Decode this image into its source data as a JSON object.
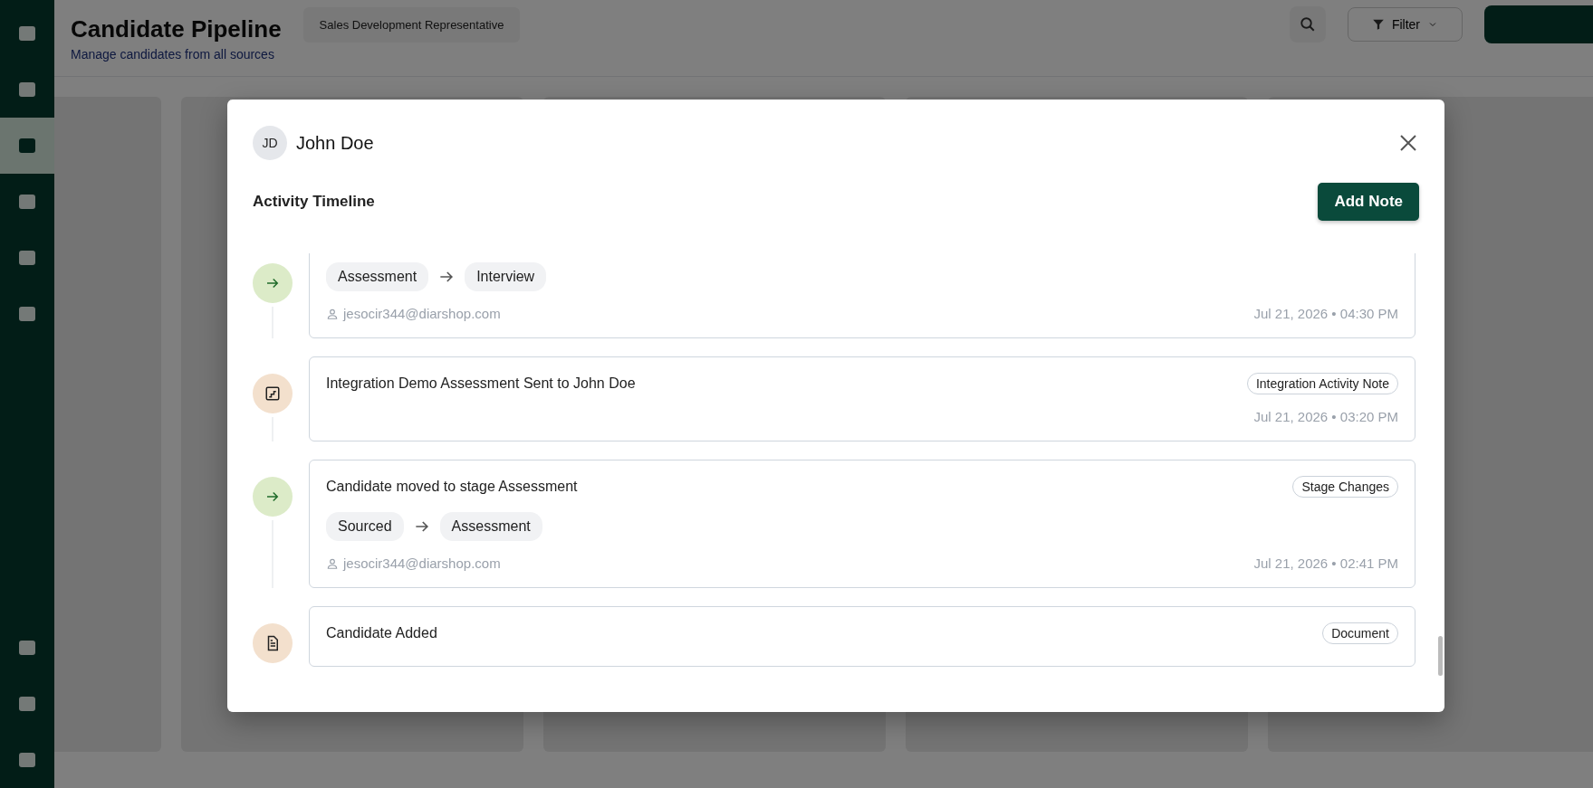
{
  "page": {
    "title": "Candidate Pipeline",
    "subtitle": "Manage candidates from all sources",
    "job_select": "Sales Development Representative",
    "filter_button": "Filter"
  },
  "sidebar": {
    "items": [
      {
        "selected": false
      },
      {
        "selected": false
      },
      {
        "selected": true
      },
      {
        "selected": false
      },
      {
        "selected": false
      },
      {
        "selected": false
      }
    ],
    "bottom_items": [
      {
        "selected": false
      },
      {
        "selected": false
      },
      {
        "selected": false
      }
    ]
  },
  "modal": {
    "avatar_initials": "JD",
    "name": "John Doe",
    "section_title": "Activity Timeline",
    "add_button": "Add Note",
    "activities": [
      {
        "kind": "stage_change",
        "from": "Assessment",
        "to": "Interview",
        "user": "jesocir344@diarshop.com",
        "time": "Jul 21, 2026 • 04:30 PM"
      },
      {
        "kind": "integration",
        "title": "Integration Demo Assessment Sent to John Doe",
        "tag": "Integration Activity Note",
        "time": "Jul 21, 2026 • 03:20 PM"
      },
      {
        "kind": "stage_change",
        "title": "Candidate moved to stage Assessment",
        "tag": "Stage Changes",
        "from": "Sourced",
        "to": "Assessment",
        "user": "jesocir344@diarshop.com",
        "time": "Jul 21, 2026 • 02:41 PM"
      },
      {
        "kind": "document",
        "title": "Candidate Added",
        "tag": "Document"
      }
    ]
  }
}
